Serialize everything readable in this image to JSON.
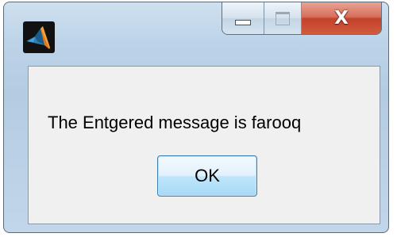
{
  "window": {
    "app_icon": "matlab-logo-icon",
    "controls": {
      "minimize_icon": "minimize-icon",
      "maximize_icon": "maximize-icon",
      "close_icon": "close-icon",
      "close_glyph": "X"
    }
  },
  "dialog": {
    "message": "The Entgered message is farooq",
    "ok_label": "OK"
  },
  "colors": {
    "frame": "#b4cce2",
    "close_button": "#c2422a",
    "client_background": "#f0f0f0",
    "ok_button": "#bee6fd"
  }
}
